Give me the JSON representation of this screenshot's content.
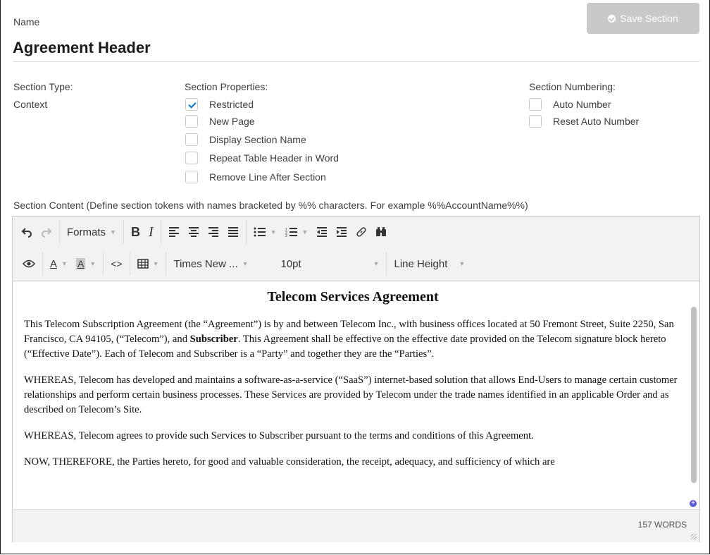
{
  "header": {
    "name_label": "Name",
    "save_label": "Save Section",
    "section_title": "Agreement Header"
  },
  "section_type": {
    "label": "Section Type:",
    "value": "Context"
  },
  "section_properties": {
    "label": "Section Properties:",
    "items": [
      {
        "label": "Restricted",
        "checked": true
      },
      {
        "label": "New Page",
        "checked": false
      },
      {
        "label": "Display Section Name",
        "checked": false
      },
      {
        "label": "Repeat Table Header in Word",
        "checked": false
      },
      {
        "label": "Remove Line After Section",
        "checked": false
      }
    ]
  },
  "section_numbering": {
    "label": "Section Numbering:",
    "items": [
      {
        "label": "Auto Number",
        "checked": false
      },
      {
        "label": "Reset Auto Number",
        "checked": false
      }
    ]
  },
  "content_label": "Section Content (Define section tokens with names bracketed by %% characters. For example %%AccountName%%)",
  "toolbar": {
    "formats": "Formats",
    "bold": "B",
    "italic": "I",
    "font_family": "Times New ...",
    "font_size": "10pt",
    "line_height": "Line Height",
    "icons": [
      "undo-icon",
      "redo-icon",
      "align-left-icon",
      "align-center-icon",
      "align-right-icon",
      "align-justify-icon",
      "bullet-list-icon",
      "numbered-list-icon",
      "outdent-icon",
      "indent-icon",
      "link-icon",
      "find-icon",
      "preview-icon",
      "text-color-icon",
      "background-color-icon",
      "source-code-icon",
      "table-icon"
    ]
  },
  "document": {
    "heading": "Telecom Services Agreement",
    "p1_a": "This Telecom Subscription Agreement (the “Agreement”) is by and between Telecom Inc., with business offices located at 50 Fremont Street, Suite 2250, San Francisco, CA 94105, (“Telecom”), and ",
    "p1_bold": "Subscriber",
    "p1_b": ". This Agreement shall be effective on the effective date provided on the Telecom signature block hereto (“Effective Date”). Each of Telecom and Subscriber is a “Party” and together they are the “Parties”.",
    "p2": "WHEREAS, Telecom has developed and maintains a software-as-a-service (“SaaS”) internet-based solution that allows End-Users to manage certain customer relationships and perform certain business processes. These Services are provided by Telecom under the trade names identified in an applicable Order and as described on Telecom’s Site.",
    "p3": "WHEREAS, Telecom agrees to provide such Services to Subscriber pursuant to the terms and conditions of this Agreement.",
    "p4": "NOW, THEREFORE, the Parties hereto, for good and valuable consideration, the receipt, adequacy, and sufficiency of which are"
  },
  "status": {
    "word_count": "157 WORDS"
  }
}
